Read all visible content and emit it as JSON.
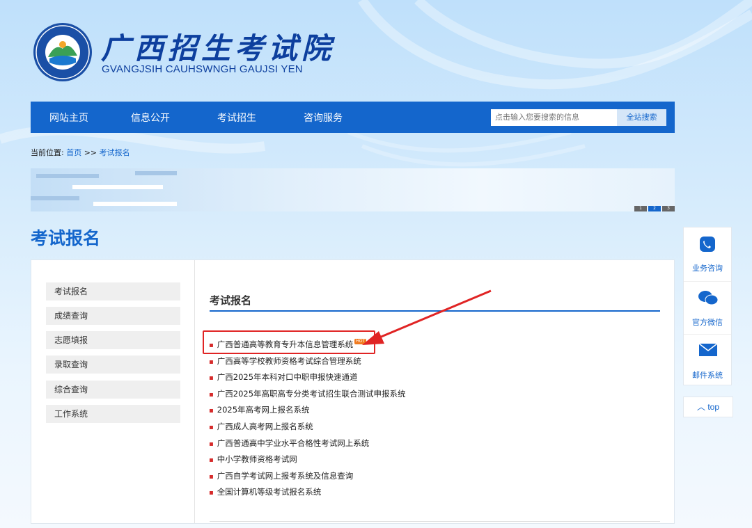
{
  "header": {
    "title": "广西招生考试院",
    "subtitle": "GVANGJSIH CAUHSWNGH GAUJSI YEN"
  },
  "nav": {
    "items": [
      "网站主页",
      "信息公开",
      "考试招生",
      "咨询服务"
    ],
    "search_placeholder": "点击输入您要搜索的信息",
    "search_button": "全站搜索"
  },
  "breadcrumb": {
    "prefix": "当前位置:",
    "home": "首页",
    "separator": ">>",
    "current": "考试报名"
  },
  "banner": {
    "pages": [
      "1",
      "2",
      "3"
    ],
    "active_page": 2
  },
  "page_heading": "考试报名",
  "sidebar": {
    "items": [
      "考试报名",
      "成绩查询",
      "志愿填报",
      "录取查询",
      "综合查询",
      "工作系统"
    ]
  },
  "content": {
    "title": "考试报名",
    "hot_badge": "HOT",
    "links": [
      "广西普通高等教育专升本信息管理系统",
      "广西高等学校教师资格考试综合管理系统",
      "广西2025年本科对口中职申报快速通道",
      "广西2025年高职高专分类考试招生联合测试申报系统",
      "2025年高考网上报名系统",
      "广西成人高考网上报名系统",
      "广西普通高中学业水平合格性考试网上系统",
      "中小学教师资格考试网",
      "广西自学考试网上报考系统及信息查询",
      "全国计算机等级考试报名系统"
    ]
  },
  "float_bar": {
    "items": [
      {
        "label": "业务咨询",
        "icon": "phone-chat-icon"
      },
      {
        "label": "官方微信",
        "icon": "wechat-icon"
      },
      {
        "label": "邮件系统",
        "icon": "mail-icon"
      }
    ],
    "top_label": "top"
  },
  "colors": {
    "primary": "#1466cc",
    "highlight": "#e02424"
  }
}
